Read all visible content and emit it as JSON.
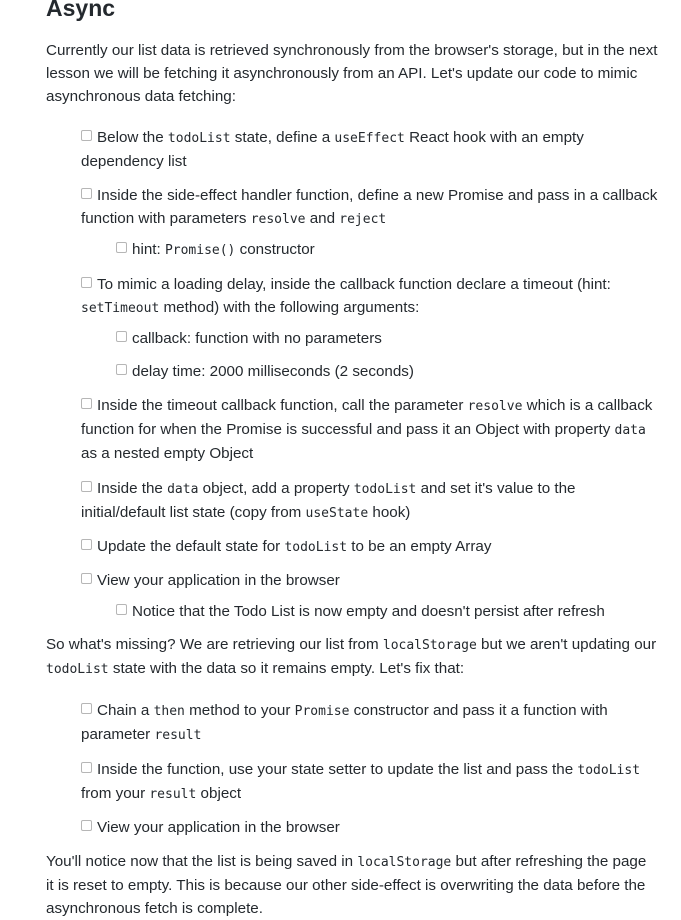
{
  "heading": "Async",
  "intro": "Currently our list data is retrieved synchronously from the browser's storage, but in the next lesson we will be fetching it asynchronously from an API. Let's update our code to mimic asynchronous data fetching:",
  "tasks1": [
    {
      "parts": [
        "Below the ",
        "todoList",
        " state, define a ",
        "useEffect",
        " React hook with an empty dependency list"
      ]
    },
    {
      "parts": [
        "Inside the side-effect handler function, define a new Promise and pass in a callback function with parameters ",
        "resolve",
        " and ",
        "reject",
        ""
      ]
    },
    {
      "parts": [
        "hint: ",
        "Promise()",
        " constructor"
      ]
    },
    {
      "parts": [
        "To mimic a loading delay, inside the callback function declare a timeout (hint: ",
        "setTimeout",
        " method) with the following arguments:"
      ]
    },
    {
      "parts": [
        "callback: function with no parameters"
      ]
    },
    {
      "parts": [
        "delay time: 2000 milliseconds (2 seconds)"
      ]
    },
    {
      "parts": [
        "Inside the timeout callback function, call the parameter ",
        "resolve",
        " which is a callback function for when the Promise is successful and pass it an Object with property ",
        "data",
        " as a nested empty Object"
      ]
    },
    {
      "parts": [
        "Inside the ",
        "data",
        " object, add a property ",
        "todoList",
        " and set it's value to the initial/default list state (copy from ",
        "useState",
        " hook)"
      ]
    },
    {
      "parts": [
        "Update the default state for ",
        "todoList",
        " to be an empty Array"
      ]
    },
    {
      "parts": [
        "View your application in the browser"
      ]
    },
    {
      "parts": [
        "Notice that the Todo List is now empty and doesn't persist after refresh"
      ]
    }
  ],
  "middle": {
    "parts": [
      "So what's missing? We are retrieving our list from ",
      "localStorage",
      " but we aren't updating our ",
      "todoList",
      " state with the data so it remains empty. Let's fix that:"
    ]
  },
  "tasks2": [
    {
      "parts": [
        "Chain a ",
        "then",
        " method to your ",
        "Promise",
        " constructor and pass it a function with parameter ",
        "result",
        ""
      ]
    },
    {
      "parts": [
        "Inside the function, use your state setter to update the list and pass the ",
        "todoList",
        " from your ",
        "result",
        " object"
      ]
    },
    {
      "parts": [
        "View your application in the browser"
      ]
    }
  ],
  "outro": {
    "parts": [
      "You'll notice now that the list is being saved in ",
      "localStorage",
      " but after refreshing the page it is reset to empty. This is because our other side-effect is overwriting the data before the asynchronous fetch is complete."
    ]
  }
}
